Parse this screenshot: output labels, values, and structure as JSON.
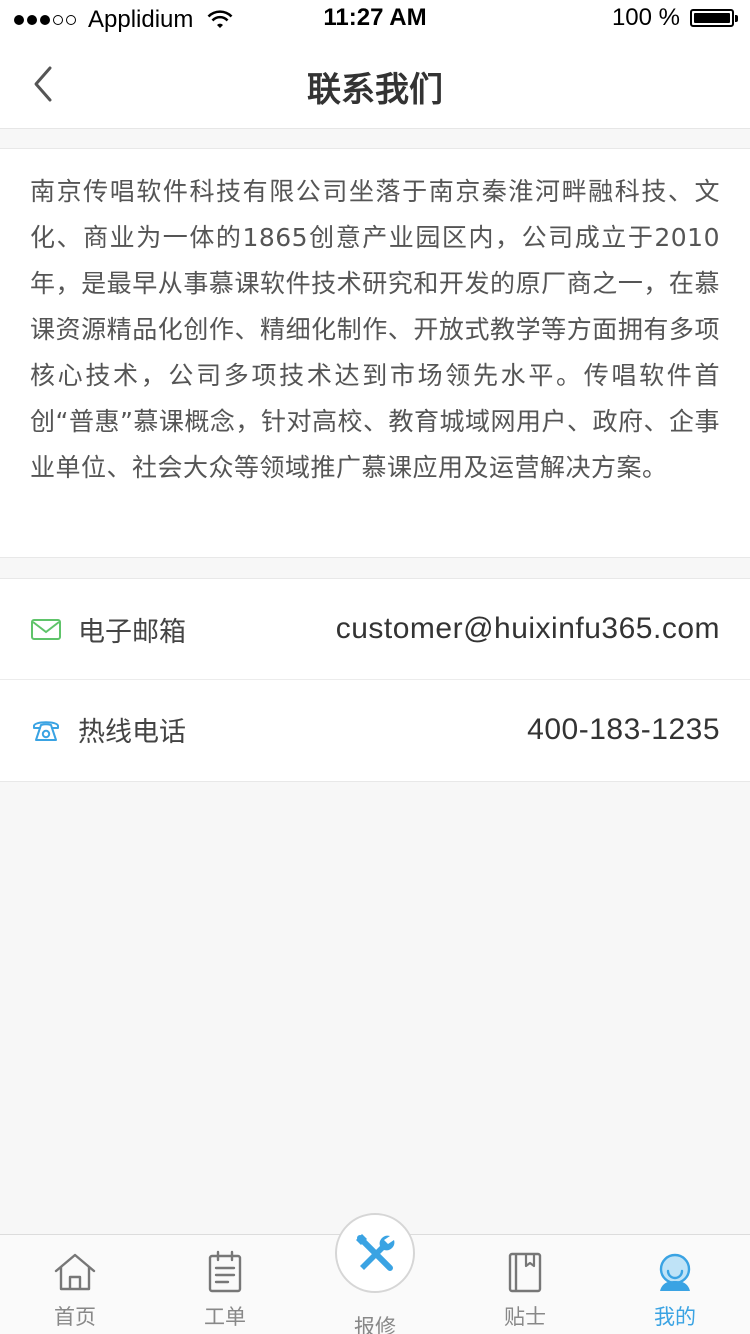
{
  "status_bar": {
    "carrier": "Applidium",
    "time": "11:27 AM",
    "battery": "100 %"
  },
  "nav": {
    "title": "联系我们"
  },
  "intro": {
    "text": "南京传唱软件科技有限公司坐落于南京秦淮河畔融科技、文化、商业为一体的1865创意产业园区内，公司成立于2010年，是最早从事慕课软件技术研究和开发的原厂商之一，在慕课资源精品化创作、精细化制作、开放式教学等方面拥有多项核心技术，公司多项技术达到市场领先水平。传唱软件首创“普惠”慕课概念，针对高校、教育城域网用户、政府、企事业单位、社会大众等领域推广慕课应用及运营解决方案。"
  },
  "contact": {
    "email": {
      "label": "电子邮箱",
      "value": "customer@huixinfu365.com",
      "icon": "mail-icon",
      "icon_color": "#5fc46a"
    },
    "phone": {
      "label": "热线电话",
      "value": "400-183-1235",
      "icon": "telephone-icon",
      "icon_color": "#3aa3e3"
    }
  },
  "tabs": [
    {
      "label": "首页",
      "icon": "home-icon"
    },
    {
      "label": "工单",
      "icon": "clipboard-icon"
    },
    {
      "label": "报修",
      "icon": "tools-icon"
    },
    {
      "label": "贴士",
      "icon": "bookmark-book-icon"
    },
    {
      "label": "我的",
      "icon": "user-avatar-icon",
      "active": true
    }
  ],
  "colors": {
    "accent": "#3aa3e3",
    "email_icon": "#5fc46a",
    "background": "#f7f7f7"
  }
}
